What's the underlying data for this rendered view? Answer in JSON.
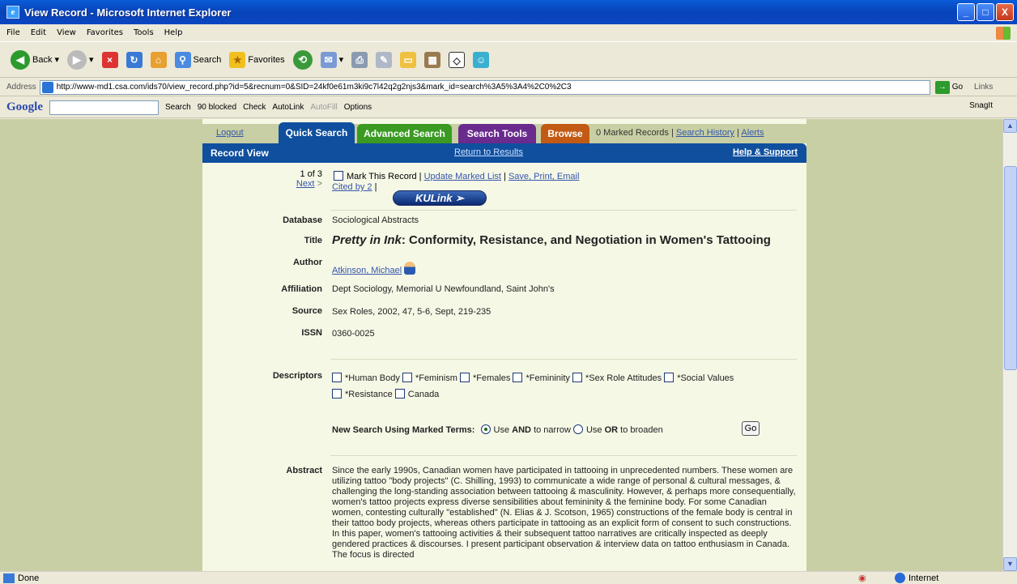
{
  "window": {
    "title": "View Record - Microsoft Internet Explorer",
    "minimize": "_",
    "maximize": "□",
    "close": "X"
  },
  "menu": [
    "File",
    "Edit",
    "View",
    "Favorites",
    "Tools",
    "Help"
  ],
  "toolbar": {
    "back": "Back",
    "search": "Search",
    "favorites": "Favorites"
  },
  "address": {
    "label": "Address",
    "url": "http://www-md1.csa.com/ids70/view_record.php?id=5&recnum=0&SID=24kf0e61m3ki9c7l42q2g2njs3&mark_id=search%3A5%3A4%2C0%2C3",
    "go": "Go",
    "links": "Links"
  },
  "googlebar": {
    "logo": "Google",
    "search": "Search",
    "blocked": "90 blocked",
    "check": "Check",
    "autolink": "AutoLink",
    "autofill": "AutoFill",
    "options": "Options",
    "snagit": "SnagIt"
  },
  "nav": {
    "logout": "Logout",
    "tabs": [
      "Quick Search",
      "Advanced Search",
      "Search Tools",
      "Browse"
    ],
    "marked_count": "0 Marked Records",
    "sep": "|",
    "history": "Search History",
    "alerts": "Alerts"
  },
  "recordbar": {
    "title": "Record View",
    "return": "Return to Results",
    "help": "Help & Support"
  },
  "pager": {
    "position": "1 of 3",
    "next": "Next",
    "next_arrow": ">"
  },
  "actions": {
    "mark": "Mark This Record",
    "update": "Update Marked List",
    "save": "Save, Print, Email",
    "cited": "Cited by 2",
    "kulink": "KULink"
  },
  "record": {
    "database_label": "Database",
    "database": "Sociological Abstracts",
    "title_label": "Title",
    "title_italic": "Pretty in Ink",
    "title_rest": ": Conformity, Resistance, and Negotiation in Women's Tattooing",
    "author_label": "Author",
    "author": "Atkinson, Michael",
    "affiliation_label": "Affiliation",
    "affiliation": "Dept Sociology, Memorial U Newfoundland, Saint John's",
    "source_label": "Source",
    "source": "Sex Roles, 2002, 47, 5-6, Sept, 219-235",
    "issn_label": "ISSN",
    "issn": "0360-0025",
    "descriptors_label": "Descriptors",
    "descriptors": [
      "*Human Body",
      "*Feminism",
      "*Females",
      "*Femininity",
      "*Sex Role Attitudes",
      "*Social Values",
      "*Resistance",
      "Canada"
    ],
    "newsearch_label": "New Search Using Marked Terms:",
    "use": "Use",
    "and": "AND",
    "to_narrow": "to narrow",
    "or": "OR",
    "to_broaden": "to broaden",
    "go": "Go",
    "abstract_label": "Abstract",
    "abstract": "Since the early 1990s, Canadian women have participated in tattooing in unprecedented numbers. These women are utilizing tattoo \"body projects\" (C. Shilling, 1993) to communicate a wide range of personal & cultural messages, & challenging the long-standing association between tattooing & masculinity. However, & perhaps more consequentially, women's tattoo projects express diverse sensibilities about femininity & the feminine body. For some Canadian women, contesting culturally \"established\" (N. Elias & J. Scotson, 1965) constructions of the female body is central in their tattoo body projects, whereas others participate in tattooing as an explicit form of consent to such constructions. In this paper, women's tattooing activities & their subsequent tattoo narratives are critically inspected as deeply gendered practices & discourses. I present participant observation & interview data on tattoo enthusiasm in Canada. The focus is directed"
  },
  "status": {
    "text": "Done",
    "zone": "Internet"
  }
}
